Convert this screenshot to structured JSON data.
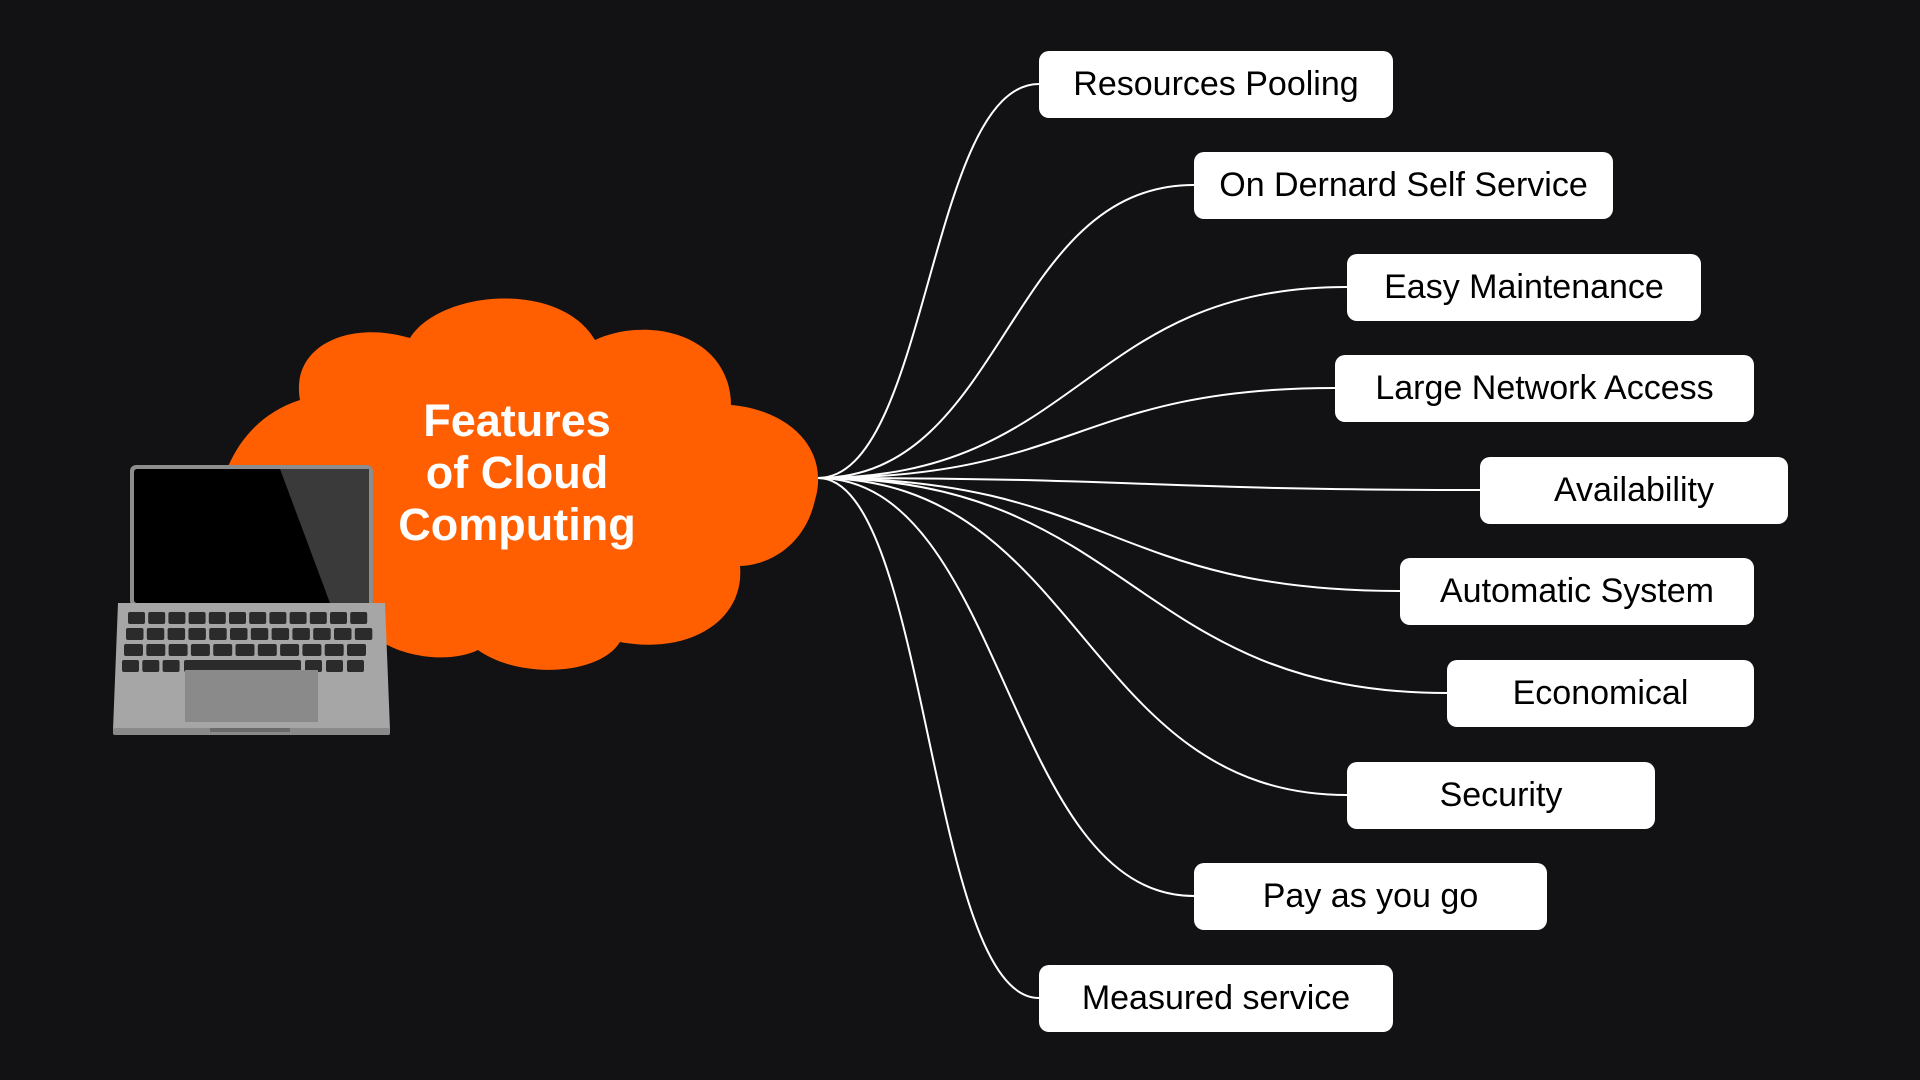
{
  "diagram": {
    "type": "mind-map",
    "central_topic": {
      "lines": [
        "Features",
        "of Cloud",
        "Computing"
      ],
      "shape": "cloud",
      "fill_color": "#FF5F00",
      "text_color": "#FFFFFF"
    },
    "illustration": "laptop-icon",
    "background_color": "#121214",
    "connector_color": "#FFFFFF",
    "node_fill": "#FFFFFF",
    "node_text_color": "#000000",
    "branches": [
      {
        "label": "Resources Pooling"
      },
      {
        "label": "On Dernard Self Service"
      },
      {
        "label": "Easy Maintenance"
      },
      {
        "label": "Large Network Access"
      },
      {
        "label": "Availability"
      },
      {
        "label": "Automatic System"
      },
      {
        "label": "Economical"
      },
      {
        "label": "Security"
      },
      {
        "label": "Pay as you go"
      },
      {
        "label": "Measured service"
      }
    ]
  }
}
